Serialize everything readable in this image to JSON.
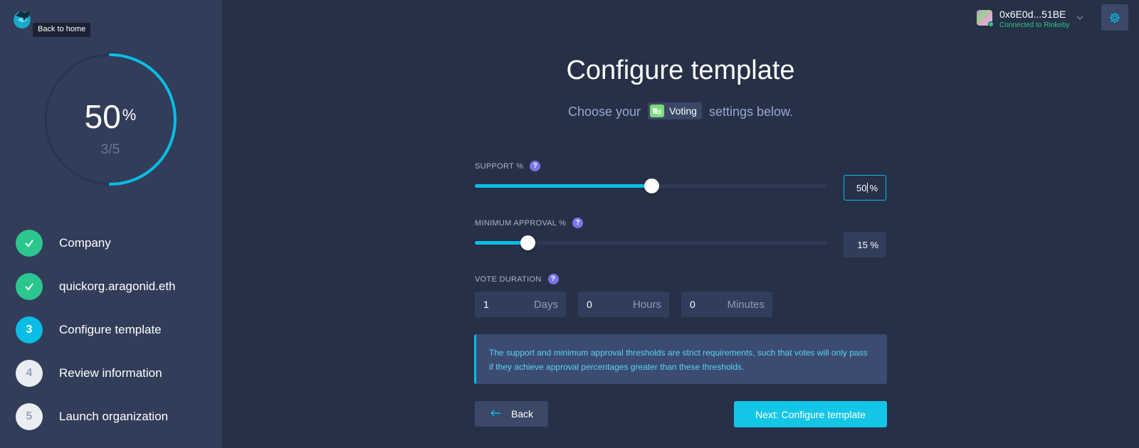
{
  "sidebar": {
    "tooltip": "Back to home",
    "progress": {
      "percent_value": 50,
      "percent": "50",
      "percent_sign": "%",
      "steps": "3/5"
    },
    "steps": [
      {
        "number": "",
        "label": "Company",
        "state": "done"
      },
      {
        "number": "",
        "label": "quickorg.aragonid.eth",
        "state": "done"
      },
      {
        "number": "3",
        "label": "Configure template",
        "state": "active"
      },
      {
        "number": "4",
        "label": "Review information",
        "state": "todo"
      },
      {
        "number": "5",
        "label": "Launch organization",
        "state": "todo"
      }
    ]
  },
  "account": {
    "address": "0x6E0d...51BE",
    "network": "Connected to Rinkeby",
    "status_color": "#2cc68f"
  },
  "main": {
    "title": "Configure template",
    "subtitle_before": "Choose your",
    "app_name": "Voting",
    "subtitle_after": "settings below.",
    "support": {
      "label": "SUPPORT %",
      "help": "?",
      "value": "50",
      "unit": "%",
      "fraction": 0.5
    },
    "min_approval": {
      "label": "MINIMUM APPROVAL %",
      "help": "?",
      "value": "15",
      "unit": "%",
      "fraction": 0.15
    },
    "vote_duration": {
      "label": "VOTE DURATION",
      "help": "?",
      "days": {
        "value": "1",
        "unit": "Days"
      },
      "hours": {
        "value": "0",
        "unit": "Hours"
      },
      "minutes": {
        "value": "0",
        "unit": "Minutes"
      }
    },
    "info": "The support and minimum approval thresholds are strict requirements, such that votes will only pass if they achieve approval percentages greater than these thresholds.",
    "back_label": "Back",
    "next_label": "Next: Configure template"
  },
  "colors": {
    "accent": "#08bee5",
    "success": "#2cc68f",
    "background": "#263047",
    "sidebar": "#323d59"
  },
  "icons": {
    "logo": "aragon-eagle-logo",
    "check": "check-icon",
    "settings": "gear-icon",
    "chevron": "chevron-down-icon",
    "help": "help-icon",
    "back": "arrow-left-icon"
  }
}
